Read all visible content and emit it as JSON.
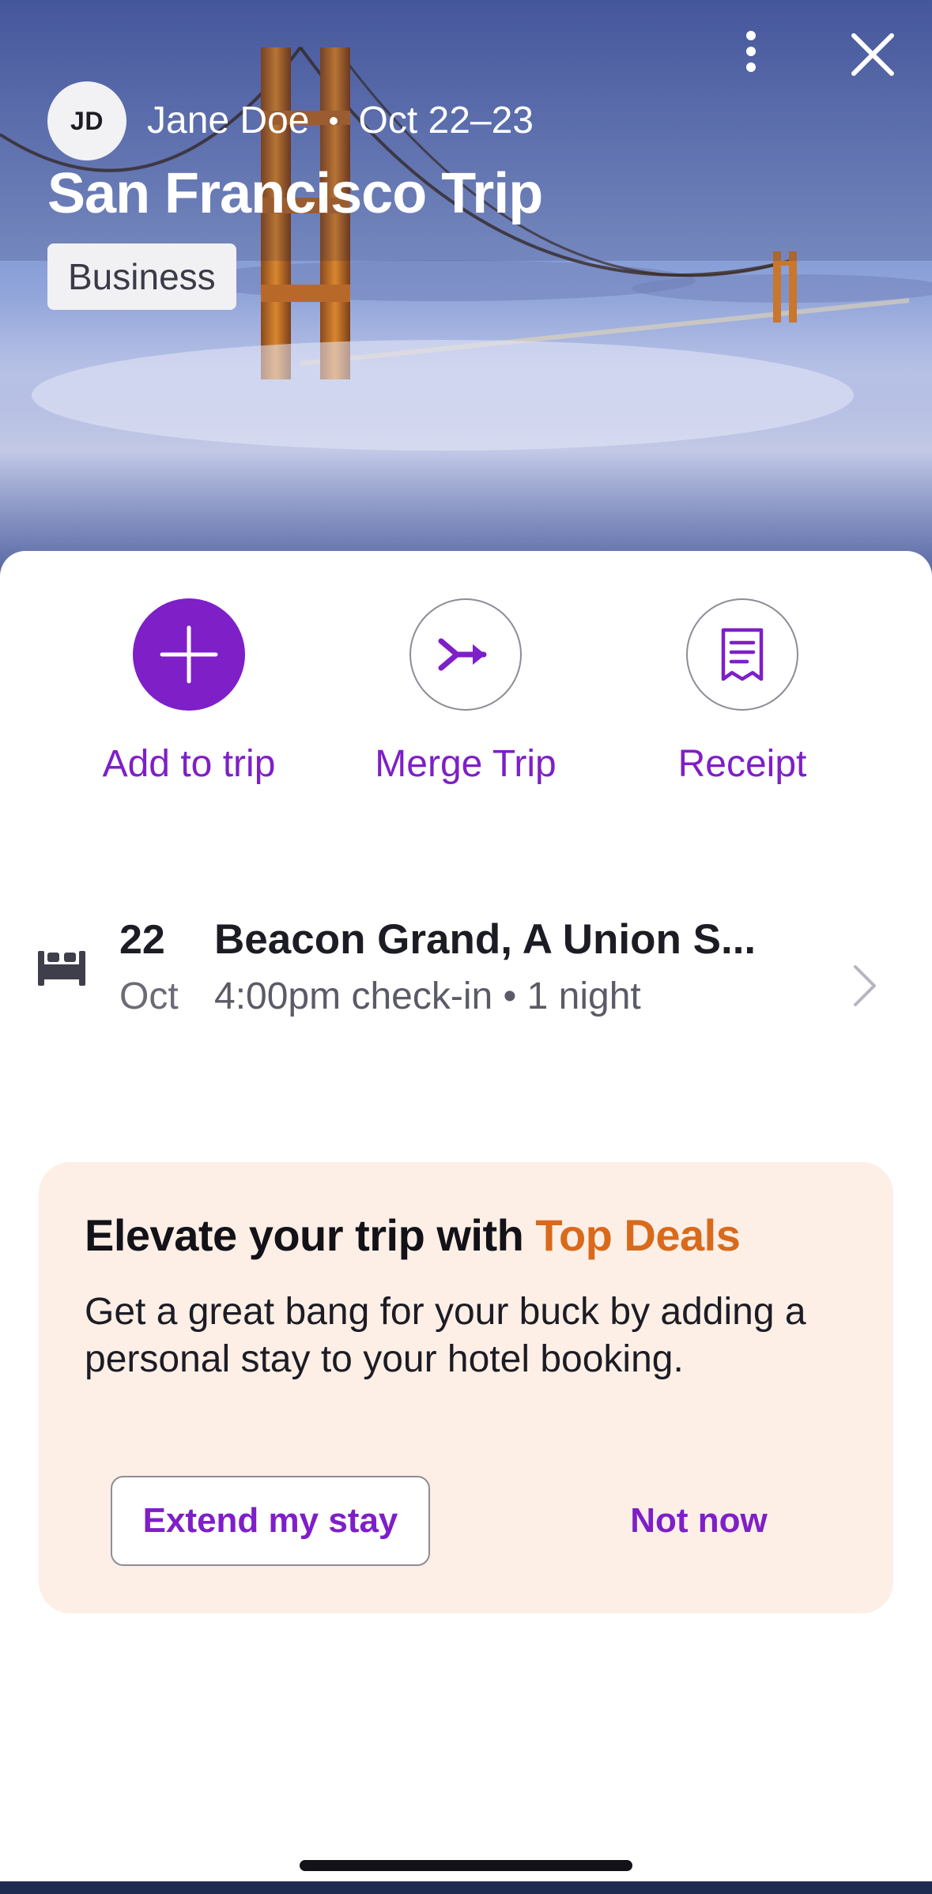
{
  "header": {
    "more_icon": "more-vertical-icon",
    "close_icon": "close-icon",
    "avatar_initials": "JD",
    "traveler_name": "Jane Doe",
    "dates": "Oct 22–23",
    "trip_title": "San Francisco Trip",
    "tag": "Business"
  },
  "actions": [
    {
      "label": "Add to trip",
      "icon": "plus-icon",
      "style": "filled"
    },
    {
      "label": "Merge Trip",
      "icon": "merge-icon",
      "style": "outlined"
    },
    {
      "label": "Receipt",
      "icon": "receipt-icon",
      "style": "outlined"
    }
  ],
  "stay": {
    "icon": "bed-icon",
    "day": "22",
    "month": "Oct",
    "hotel_name": "Beacon Grand, A Union S...",
    "detail": "4:00pm check-in • 1 night"
  },
  "deal": {
    "title_prefix": "Elevate your trip with",
    "title_accent": "Top Deals",
    "body": "Get a great bang for your buck by adding a personal stay to your hotel booking.",
    "primary_button": "Extend my stay",
    "secondary_button": "Not now"
  },
  "colors": {
    "brand_purple": "#7e1fc8",
    "accent_orange": "#d96a1c",
    "deal_background": "#fdefe6"
  }
}
